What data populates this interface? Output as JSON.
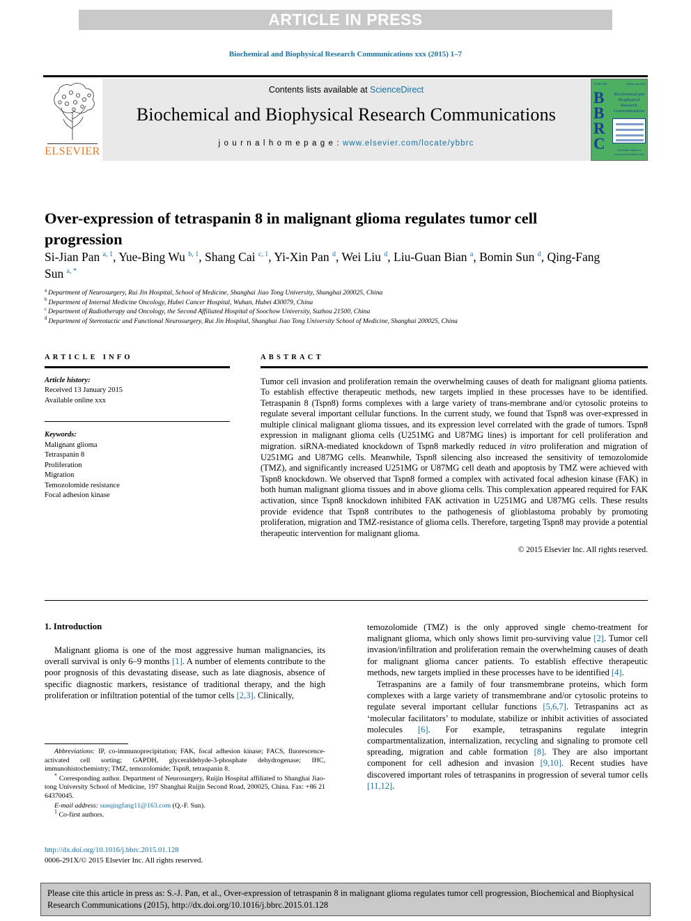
{
  "banner": {
    "text": "ARTICLE IN PRESS"
  },
  "running_head": "Biochemical and Biophysical Research Communications xxx (2015) 1–7",
  "masthead": {
    "contents_prefix": "Contents lists available at ",
    "contents_link": "ScienceDirect",
    "journal_title": "Biochemical and Biophysical Research Communications",
    "homepage_prefix": "j o u r n a l   h o m e p a g e :  ",
    "homepage_url": "www.elsevier.com/locate/ybbrc",
    "publisher_name": "ELSEVIER",
    "cover": {
      "letters": "BBRC",
      "title": "Biochemical and Biophysical Research Communications",
      "top_left": "ELSEVIER",
      "top_right": "Volume xxx 2015",
      "bottom": "Available online at www.sciencedirect.com"
    }
  },
  "title": "Over-expression of tetraspanin 8 in malignant glioma regulates tumor cell progression",
  "authors": [
    {
      "name": "Si-Jian Pan",
      "marks": "a, 1",
      "sep": ", "
    },
    {
      "name": "Yue-Bing Wu",
      "marks": "b, 1",
      "sep": ", "
    },
    {
      "name": "Shang Cai",
      "marks": "c, 1",
      "sep": ", "
    },
    {
      "name": "Yi-Xin Pan",
      "marks": "d",
      "sep": ", "
    },
    {
      "name": "Wei Liu",
      "marks": "d",
      "sep": ", "
    },
    {
      "name": "Liu-Guan Bian",
      "marks": "a",
      "sep": ", "
    },
    {
      "name": "Bomin Sun",
      "marks": "d",
      "sep": ", "
    },
    {
      "name": "Qing-Fang Sun",
      "marks": "a, *",
      "sep": ""
    }
  ],
  "affiliations": [
    {
      "mark": "a",
      "text": "Department of Neurosurgery, Rui Jin Hospital, School of Medicine, Shanghai Jiao Tong University, Shanghai 200025, China"
    },
    {
      "mark": "b",
      "text": "Department of Internal Medicine Oncology, Hubei Cancer Hospital, Wuhan, Hubei 430079, China"
    },
    {
      "mark": "c",
      "text": "Department of Radiotherapy and Oncology, the Second Affiliated Hospital of Soochow University, Suzhou 21500, China"
    },
    {
      "mark": "d",
      "text": "Department of Stereotactic and Functional Neurosurgery, Rui Jin Hospital, Shanghai Jiao Tong University School of Medicine, Shanghai 200025, China"
    }
  ],
  "article_info": {
    "heading": "ARTICLE INFO",
    "history_label": "Article history:",
    "history_lines": [
      "Received 13 January 2015",
      "Available online xxx"
    ],
    "keywords_label": "Keywords:",
    "keywords": [
      "Malignant glioma",
      "Tetraspanin 8",
      "Proliferation",
      "Migration",
      "Temozolomide resistance",
      "Focal adhesion kinase"
    ]
  },
  "abstract": {
    "heading": "ABSTRACT",
    "part1": "Tumor cell invasion and proliferation remain the overwhelming causes of death for malignant glioma patients. To establish effective therapeutic methods, new targets implied in these processes have to be identified. Tetraspanin 8 (Tspn8) forms complexes with a large variety of trans-membrane and/or cytosolic proteins to regulate several important cellular functions. In the current study, we found that Tspn8 was over-expressed in multiple clinical malignant glioma tissues, and its expression level correlated with the grade of tumors. Tspn8 expression in malignant glioma cells (U251MG and U87MG lines) is important for cell proliferation and migration. siRNA-mediated knockdown of Tspn8 markedly reduced ",
    "italic1": "in vitro",
    "part2": " proliferation and migration of U251MG and U87MG cells. Meanwhile, Tspn8 silencing also increased the sensitivity of temozolomide (TMZ), and significantly increased U251MG or U87MG cell death and apoptosis by TMZ were achieved with Tspn8 knockdown. We observed that Tspn8 formed a complex with activated focal adhesion kinase (FAK) in both human malignant glioma tissues and in above glioma cells. This complexation appeared required for FAK activation, since Tspn8 knockdown inhibited FAK activation in U251MG and U87MG cells. These results provide evidence that Tspn8 contributes to the pathogenesis of glioblastoma probably by promoting proliferation, migration and TMZ-resistance of glioma cells. Therefore, targeting Tspn8 may provide a potential therapeutic intervention for malignant glioma.",
    "copyright": "© 2015 Elsevier Inc. All rights reserved."
  },
  "introduction": {
    "heading": "1.  Introduction",
    "left_paragraphs": [
      {
        "segments": [
          {
            "t": "Malignant glioma is one of the most aggressive human malignancies, its overall survival is only 6–9 months "
          },
          {
            "t": "[1]",
            "ref": true
          },
          {
            "t": ". A number of elements contribute to the poor prognosis of this devastating disease, such as late diagnosis, absence of specific diagnostic markers, resistance of traditional therapy, and the high proliferation or infiltration potential of the tumor cells "
          },
          {
            "t": "[2,3]",
            "ref": true
          },
          {
            "t": ". Clinically,"
          }
        ]
      }
    ],
    "right_paragraphs": [
      {
        "indent": false,
        "segments": [
          {
            "t": "temozolomide (TMZ) is the only approved single chemo-treatment for malignant glioma, which only shows limit pro-surviving value "
          },
          {
            "t": "[2]",
            "ref": true
          },
          {
            "t": ". Tumor cell invasion/infiltration and proliferation remain the overwhelming causes of death for malignant glioma cancer patients. To establish effective therapeutic methods, new targets implied in these processes have to be identified "
          },
          {
            "t": "[4]",
            "ref": true
          },
          {
            "t": "."
          }
        ]
      },
      {
        "indent": true,
        "segments": [
          {
            "t": "Tetraspanins are a family of four transmembrane proteins, which form complexes with a large variety of transmembrane and/or cytosolic proteins to regulate several important cellular functions "
          },
          {
            "t": "[5,6,7]",
            "ref": true
          },
          {
            "t": ". Tetraspanins act as ‘molecular facilitators’ to modulate, stabilize or inhibit activities of associated molecules "
          },
          {
            "t": "[6]",
            "ref": true
          },
          {
            "t": ". For example, tetraspanins regulate integrin compartmentalization, internalization, recycling and signaling to promote cell spreading, migration and cable formation "
          },
          {
            "t": "[8]",
            "ref": true
          },
          {
            "t": ". They are also important component for cell adhesion and invasion "
          },
          {
            "t": "[9,10]",
            "ref": true
          },
          {
            "t": ". Recent studies have discovered important roles of tetraspanins in progression of several tumor cells "
          },
          {
            "t": "[11,12]",
            "ref": true
          },
          {
            "t": "."
          }
        ]
      }
    ]
  },
  "footnotes": {
    "abbreviations_label": "Abbreviations:",
    "abbreviations_text": " IP, co-immunoprecipitation; FAK, focal adhesion kinase; FACS, fluorescence-activated cell sorting; GAPDH, glyceraldehyde-3-phosphate dehydrogenase; IHC, immunohistochemistry; TMZ, temozolomide; Tspn8, tetraspanin 8.",
    "corresponding_mark": "*",
    "corresponding_text": " Corresponding author. Department of Neurosurgery, Ruijin Hospital affiliated to Shanghai Jiao-tong University School of Medicine, 197 Shanghai Ruijin Second Road, 200025, China. Fax: +86 21 64370045.",
    "email_label": "E-mail address:",
    "email_value": "sunqingfang11@163.com",
    "email_suffix": " (Q.-F. Sun).",
    "cofirst_mark": "1",
    "cofirst_text": " Co-first authors."
  },
  "doi_block": {
    "doi_url": "http://dx.doi.org/10.1016/j.bbrc.2015.01.128",
    "issn_line": "0006-291X/© 2015 Elsevier Inc. All rights reserved."
  },
  "citation_footer": "Please cite this article in press as: S.-J. Pan, et al., Over-expression of tetraspanin 8 in malignant glioma regulates tumor cell progression, Biochemical and Biophysical Research Communications (2015), http://dx.doi.org/10.1016/j.bbrc.2015.01.128",
  "colors": {
    "link": "#1471a6",
    "banner_bg": "#c8c8c8",
    "masthead_bg": "#e9e9e9",
    "elsevier_orange": "#e87722",
    "cover_green": "#4caf62",
    "cover_blue": "#1c3f94"
  }
}
